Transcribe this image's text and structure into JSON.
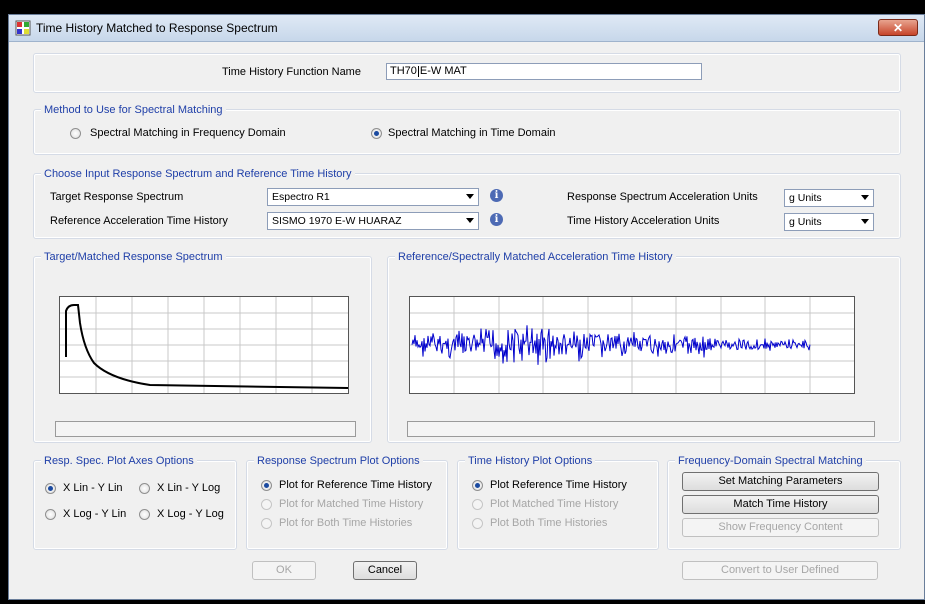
{
  "window": {
    "title": "Time History Matched to Response Spectrum",
    "close_symbol": "✕"
  },
  "function_name": {
    "label": "Time History Function Name",
    "value_before_caret": "TH70",
    "value_after_caret": "E-W MAT"
  },
  "method": {
    "title": "Method to Use for Spectral Matching",
    "options": [
      {
        "label": "Spectral Matching in Frequency Domain",
        "selected": false
      },
      {
        "label": "Spectral Matching in Time Domain",
        "selected": true
      }
    ]
  },
  "input": {
    "title": "Choose Input Response Spectrum and Reference Time History",
    "target_label": "Target Response Spectrum",
    "target_value": "Espectro R1",
    "reference_label": "Reference Acceleration Time History",
    "reference_value": "SISMO 1970  E-W  HUARAZ",
    "rs_units_label": "Response Spectrum Acceleration Units",
    "rs_units_value": "g Units",
    "th_units_label": "Time History Acceleration Units",
    "th_units_value": "g Units",
    "info_icon": "i"
  },
  "plots": {
    "spectrum_title": "Target/Matched Response Spectrum",
    "history_title": "Reference/Spectrally Matched Acceleration Time History"
  },
  "axes_options": {
    "title": "Resp. Spec. Plot Axes Options",
    "options": [
      {
        "label": "X Lin - Y Lin",
        "selected": true
      },
      {
        "label": "X Lin - Y Log",
        "selected": false
      },
      {
        "label": "X Log - Y Lin",
        "selected": false
      },
      {
        "label": "X Log - Y Log",
        "selected": false
      }
    ]
  },
  "rs_plot_options": {
    "title": "Response Spectrum Plot Options",
    "options": [
      {
        "label": "Plot for Reference Time History",
        "selected": true,
        "enabled": true
      },
      {
        "label": "Plot for Matched Time History",
        "selected": false,
        "enabled": false
      },
      {
        "label": "Plot for Both Time Histories",
        "selected": false,
        "enabled": false
      }
    ]
  },
  "th_plot_options": {
    "title": "Time History Plot Options",
    "options": [
      {
        "label": "Plot Reference Time History",
        "selected": true,
        "enabled": true
      },
      {
        "label": "Plot Matched Time History",
        "selected": false,
        "enabled": false
      },
      {
        "label": "Plot Both Time Histories",
        "selected": false,
        "enabled": false
      }
    ]
  },
  "freq_matching": {
    "title": "Frequency-Domain Spectral Matching",
    "set_params": "Set Matching Parameters",
    "match": "Match Time History",
    "show_freq": "Show Frequency Content"
  },
  "footer": {
    "ok": "OK",
    "cancel": "Cancel",
    "convert": "Convert to User Defined"
  },
  "colors": {
    "panel_title": "#1f3fa8",
    "signal": "#0000cc",
    "spectrum": "#000000"
  }
}
